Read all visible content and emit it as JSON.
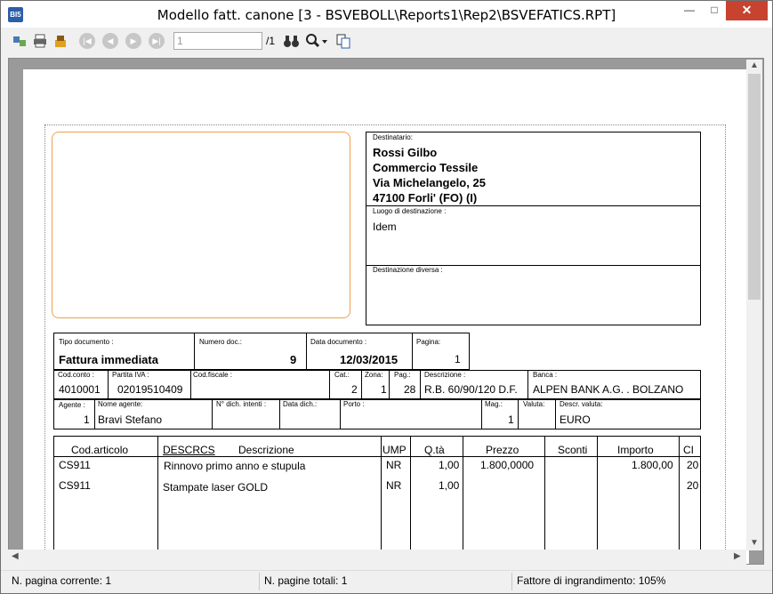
{
  "window": {
    "icon_text": "BI5",
    "title": "Modello fatt. canone [3 - BSVEBOLL\\Reports1\\Rep2\\BSVEFATICS.RPT]",
    "minimize": "—",
    "maximize": "□",
    "close": "✕"
  },
  "toolbar": {
    "page_input": "1",
    "page_total": "/1"
  },
  "report": {
    "destinatario_label": "Destinatario:",
    "dest_line1": "Rossi Gilbo",
    "dest_line2": "Commercio Tessile",
    "dest_line3": "Via Michelangelo, 25",
    "dest_line4": "47100 Forli' (FO) (I)",
    "luogo_label": "Luogo di destinazione :",
    "luogo_value": "Idem",
    "dest_diversa_label": "Destinazione diversa :",
    "tipo_doc_label": "Tipo documento :",
    "tipo_doc_value": "Fattura immediata",
    "numero_doc_label": "Numero doc.:",
    "numero_doc_value": "9",
    "data_doc_label": "Data documento :",
    "data_doc_value": "12/03/2015",
    "pagina_label": "Pagina:",
    "pagina_value": "1",
    "cod_conto_label": "Cod.conto :",
    "cod_conto_value": "4010001",
    "partita_iva_label": "Partita IVA :",
    "partita_iva_value": "02019510409",
    "cod_fiscale_label": "Cod.fiscale :",
    "cat_label": "Cat.:",
    "cat_value": "2",
    "zona_label": "Zona:",
    "zona_value": "1",
    "pag_label": "Pag.:",
    "pag_value": "28",
    "descrizione_label": "Descrizione :",
    "descrizione_value": "R.B. 60/90/120 D.F.",
    "banca_label": "Banca :",
    "banca_value": "ALPEN BANK A.G. . BOLZANO",
    "agente_label": "Agente :",
    "agente_value": "1",
    "nome_agente_label": "Nome agente:",
    "nome_agente_value": "Bravi Stefano",
    "dich_intenti_label": "N° dich. intenti :",
    "data_dich_label": "Data dich.:",
    "porto_label": "Porto :",
    "mag_label": "Mag.:",
    "mag_value": "1",
    "valuta_label": "Valuta:",
    "descr_valuta_label": "Descr. valuta:",
    "descr_valuta_value": "EURO",
    "columns": [
      "Cod.articolo",
      "DESCRCS",
      "Descrizione",
      "UMP",
      "Q.tà",
      "Prezzo",
      "Sconti",
      "Importo",
      "CI"
    ],
    "rows": [
      {
        "cod": "CS911",
        "descr": "Rinnovo primo anno e stupula",
        "ump": "NR",
        "qta": "1,00",
        "prezzo": "1.800,0000",
        "importo": "1.800,00",
        "ci": "20"
      },
      {
        "cod": "CS911",
        "descr": "Stampate laser GOLD",
        "ump": "NR",
        "qta": "1,00",
        "prezzo": "",
        "importo": "",
        "ci": "20"
      }
    ]
  },
  "status": {
    "pagina_corrente": "N. pagina corrente: 1",
    "pagine_totali": "N. pagine totali: 1",
    "fattore": "Fattore di ingrandimento: 105%"
  },
  "colors": {
    "close_button": "#c7432f",
    "logo_border": "#f0a050",
    "viewport_bg": "#9a9a9a"
  }
}
